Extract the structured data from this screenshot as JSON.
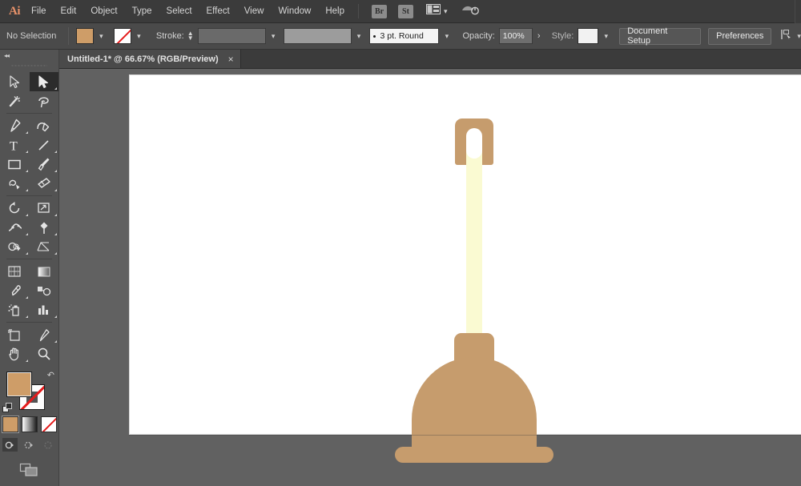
{
  "app": {
    "name": "Adobe Illustrator",
    "logo_text": "Ai"
  },
  "menubar": {
    "items": [
      {
        "label": "File"
      },
      {
        "label": "Edit"
      },
      {
        "label": "Object"
      },
      {
        "label": "Type"
      },
      {
        "label": "Select"
      },
      {
        "label": "Effect"
      },
      {
        "label": "View"
      },
      {
        "label": "Window"
      },
      {
        "label": "Help"
      }
    ],
    "bridge_badge": "Br",
    "stock_badge": "St",
    "arrange_icon": "arrange-documents-icon",
    "cclibraries_icon": "creative-cloud-sync-icon"
  },
  "controlbar": {
    "selection_status": "No Selection",
    "fill_label": "fill-swatch",
    "fill_color": "#CE9D68",
    "stroke_swatch_label": "stroke-swatch-none",
    "stroke_label": "Stroke:",
    "stroke_weight_value": "",
    "brush_definition": "3 pt. Round",
    "opacity_label": "Opacity:",
    "opacity_value": "100%",
    "style_label": "Style:",
    "style_color": "#F2F2F2",
    "document_setup_button": "Document Setup",
    "preferences_button": "Preferences",
    "align_icon": "align-to-selection-icon"
  },
  "tabs": [
    {
      "title": "Untitled-1* @ 66.67% (RGB/Preview)",
      "close_label": "×",
      "active": true
    }
  ],
  "toolbar": {
    "collapse_label": "◂◂",
    "tools": [
      {
        "name": "selection-tool",
        "label": "Selection Tool",
        "active": false,
        "flyout": false
      },
      {
        "name": "direct-selection-tool",
        "label": "Direct Selection Tool",
        "active": true,
        "flyout": true
      },
      {
        "name": "magic-wand-tool",
        "label": "Magic Wand Tool",
        "active": false,
        "flyout": false
      },
      {
        "name": "lasso-tool",
        "label": "Lasso Tool",
        "active": false,
        "flyout": false
      },
      {
        "name": "pen-tool",
        "label": "Pen Tool",
        "active": false,
        "flyout": true
      },
      {
        "name": "curvature-tool",
        "label": "Curvature Tool",
        "active": false,
        "flyout": false
      },
      {
        "name": "type-tool",
        "label": "Type Tool",
        "active": false,
        "flyout": true
      },
      {
        "name": "line-segment-tool",
        "label": "Line Segment Tool",
        "active": false,
        "flyout": true
      },
      {
        "name": "rectangle-tool",
        "label": "Rectangle Tool",
        "active": false,
        "flyout": true
      },
      {
        "name": "paintbrush-tool",
        "label": "Paintbrush Tool",
        "active": false,
        "flyout": true
      },
      {
        "name": "shaper-tool",
        "label": "Shaper Tool",
        "active": false,
        "flyout": true
      },
      {
        "name": "eraser-tool",
        "label": "Eraser Tool",
        "active": false,
        "flyout": true
      },
      {
        "name": "rotate-tool",
        "label": "Rotate Tool",
        "active": false,
        "flyout": true
      },
      {
        "name": "scale-tool",
        "label": "Scale Tool",
        "active": false,
        "flyout": true
      },
      {
        "name": "width-tool",
        "label": "Width Tool",
        "active": false,
        "flyout": true
      },
      {
        "name": "free-transform-tool",
        "label": "Free Transform Tool",
        "active": false,
        "flyout": true
      },
      {
        "name": "shape-builder-tool",
        "label": "Shape Builder Tool",
        "active": false,
        "flyout": true
      },
      {
        "name": "perspective-grid-tool",
        "label": "Perspective Grid Tool",
        "active": false,
        "flyout": true
      },
      {
        "name": "mesh-tool",
        "label": "Mesh Tool",
        "active": false,
        "flyout": false
      },
      {
        "name": "gradient-tool",
        "label": "Gradient Tool",
        "active": false,
        "flyout": false
      },
      {
        "name": "eyedropper-tool",
        "label": "Eyedropper Tool",
        "active": false,
        "flyout": true
      },
      {
        "name": "blend-tool",
        "label": "Blend Tool",
        "active": false,
        "flyout": false
      },
      {
        "name": "symbol-sprayer-tool",
        "label": "Symbol Sprayer Tool",
        "active": false,
        "flyout": true
      },
      {
        "name": "column-graph-tool",
        "label": "Column Graph Tool",
        "active": false,
        "flyout": true
      },
      {
        "name": "artboard-tool",
        "label": "Artboard Tool",
        "active": false,
        "flyout": false
      },
      {
        "name": "slice-tool",
        "label": "Slice Tool",
        "active": false,
        "flyout": true
      },
      {
        "name": "hand-tool",
        "label": "Hand Tool",
        "active": false,
        "flyout": true
      },
      {
        "name": "zoom-tool",
        "label": "Zoom Tool",
        "active": false,
        "flyout": false
      }
    ],
    "fill_color": "#CE9D68",
    "stroke_color": "none",
    "swap_icon": "swap-fill-stroke-icon",
    "default_icon": "default-fill-stroke-icon",
    "paint_modes": [
      {
        "name": "color-mode-button",
        "label": "Color",
        "selected": true
      },
      {
        "name": "gradient-mode-button",
        "label": "Gradient",
        "selected": false
      },
      {
        "name": "none-mode-button",
        "label": "None",
        "selected": false
      }
    ],
    "drawing_modes": [
      {
        "name": "draw-normal-button",
        "label": "Draw Normal",
        "selected": true,
        "disabled": false
      },
      {
        "name": "draw-behind-button",
        "label": "Draw Behind",
        "selected": false,
        "disabled": false
      },
      {
        "name": "draw-inside-button",
        "label": "Draw Inside",
        "selected": false,
        "disabled": true
      }
    ],
    "screen_mode": {
      "name": "change-screen-mode-button",
      "label": "Change Screen Mode"
    }
  },
  "canvas": {
    "background_color": "#616161",
    "artboard_color": "#FFFFFF",
    "zoom_level": "66.67%",
    "color_mode": "RGB",
    "view_mode": "Preview",
    "artwork": {
      "name": "plunger-illustration",
      "description": "Flat vector illustration of a toilet plunger",
      "parts": [
        {
          "name": "plunger-handle-grip",
          "color": "#C69C6D"
        },
        {
          "name": "plunger-handle-hole",
          "color": "#FFFFFF"
        },
        {
          "name": "plunger-shaft",
          "color": "#FAFAD2"
        },
        {
          "name": "plunger-neck",
          "color": "#C69C6D"
        },
        {
          "name": "plunger-cup",
          "color": "#C69C6D"
        },
        {
          "name": "plunger-lip",
          "color": "#C69C6D"
        }
      ]
    }
  }
}
